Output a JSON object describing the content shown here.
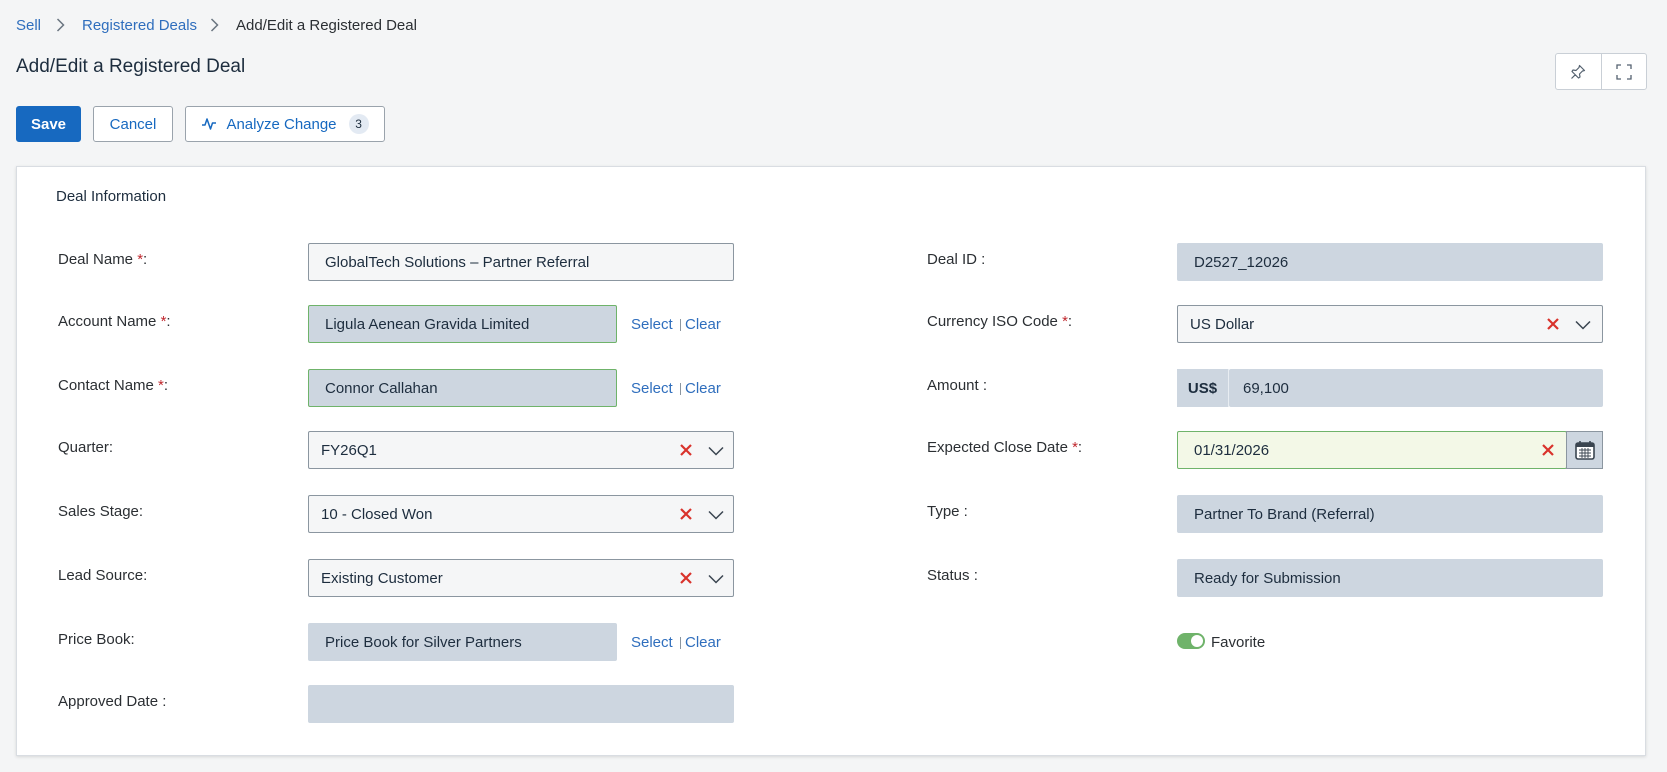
{
  "breadcrumb": {
    "items": [
      "Sell",
      "Registered Deals",
      "Add/Edit a Registered Deal"
    ]
  },
  "page": {
    "title": "Add/Edit a Registered Deal"
  },
  "header_icons": [
    "pin-icon",
    "fullscreen-icon"
  ],
  "toolbar": {
    "save_label": "Save",
    "cancel_label": "Cancel",
    "analyze_label": "Analyze Change",
    "analyze_count": "3"
  },
  "section": {
    "title": "Deal Information"
  },
  "left": {
    "deal_name": {
      "label": "Deal Name",
      "suffix": ":",
      "value": "GlobalTech Solutions – Partner Referral"
    },
    "account_name": {
      "label": "Account Name",
      "suffix": ":",
      "value": "Ligula Aenean Gravida Limited"
    },
    "contact_name": {
      "label": "Contact Name",
      "suffix": ":",
      "value": "Connor Callahan"
    },
    "quarter": {
      "label": "Quarter:",
      "value": "FY26Q1"
    },
    "sales_stage": {
      "label": "Sales Stage:",
      "value": "10 - Closed Won"
    },
    "lead_source": {
      "label": "Lead Source:",
      "value": "Existing Customer"
    },
    "price_book": {
      "label": "Price Book:",
      "value": "Price Book for Silver Partners"
    },
    "approved_date": {
      "label": "Approved Date :",
      "value": ""
    }
  },
  "right": {
    "deal_id": {
      "label": "Deal ID :",
      "value": "D2527_12026"
    },
    "currency": {
      "label": "Currency ISO Code",
      "suffix": ":",
      "value": "US Dollar"
    },
    "amount": {
      "label": "Amount :",
      "prefix": "US$",
      "value": "69,100"
    },
    "close_date": {
      "label": "Expected Close Date ",
      "suffix": ":",
      "value": "01/31/2026"
    },
    "type": {
      "label": "Type :",
      "value": "Partner To Brand (Referral)"
    },
    "status": {
      "label": "Status :",
      "value": "Ready for Submission"
    },
    "favorite": {
      "label": "Favorite",
      "on": true
    }
  },
  "actions": {
    "select": "Select",
    "clear": "Clear"
  },
  "required_mark": "*",
  "colors": {
    "primary": "#1769c0",
    "link": "#2f6ebd",
    "clear_x": "#d9322b",
    "valid_border": "#6fb36a",
    "readonly_bg": "#cdd6e0"
  }
}
